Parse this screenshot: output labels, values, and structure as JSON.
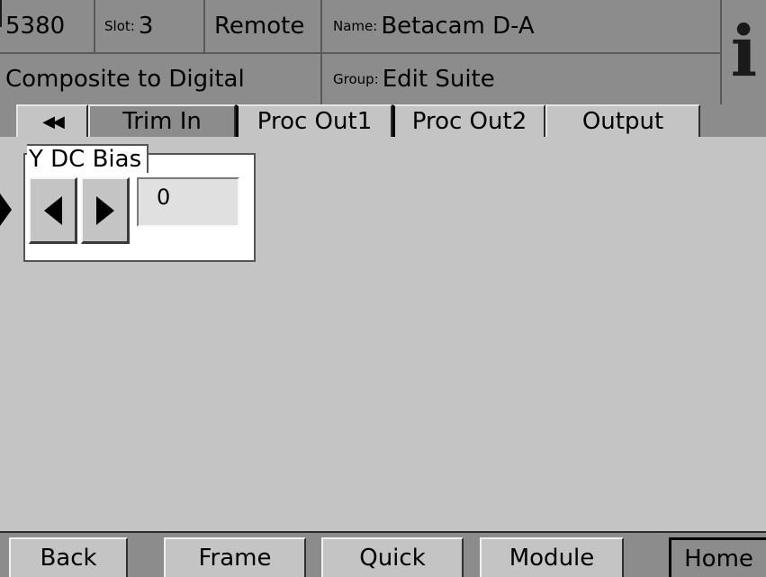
{
  "header": {
    "model": "5380",
    "slot_label": "Slot:",
    "slot_value": "3",
    "mode": "Remote",
    "name_label": "Name:",
    "name_value": "Betacam D-A",
    "function": "Composite to Digital",
    "group_label": "Group:",
    "group_value": "Edit Suite",
    "info_glyph": "i"
  },
  "tabs": {
    "scroll_back_glyph": "◀◀",
    "items": [
      "Trim In",
      "Proc Out1",
      "Proc Out2",
      "Output"
    ],
    "active": "Proc Out1"
  },
  "control": {
    "title": "Y DC Bias",
    "value": "0",
    "decrement_icon": "left-triangle-icon",
    "increment_icon": "right-triangle-icon",
    "selection_marker_icon": "selection-marker-icon"
  },
  "footer": {
    "buttons": [
      "Back",
      "Frame",
      "Quick",
      "Module",
      "Home"
    ]
  }
}
